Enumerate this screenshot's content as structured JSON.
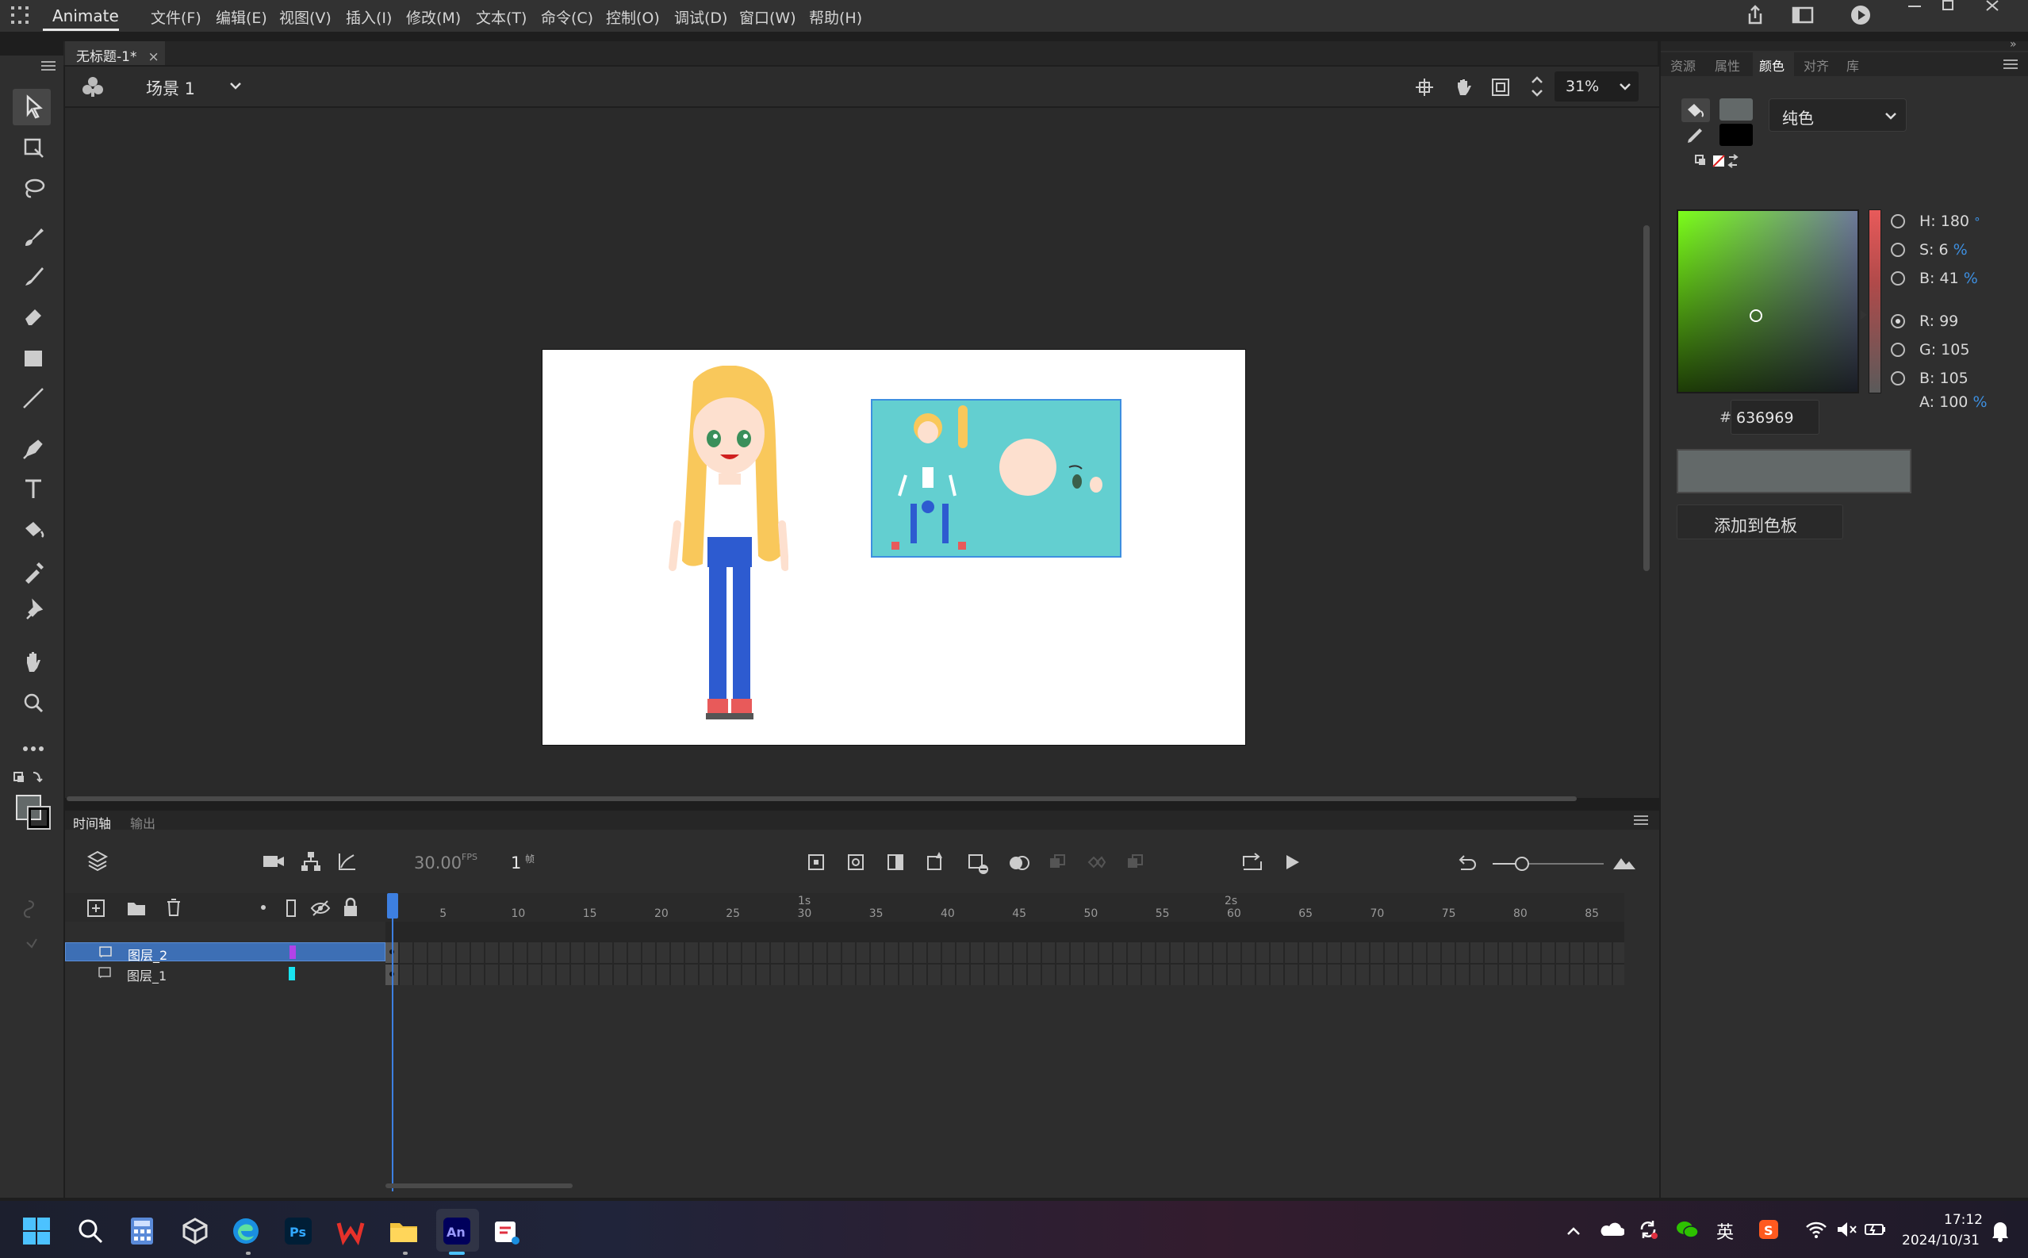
{
  "menubar": {
    "app_name": "Animate",
    "menus": [
      "文件(F)",
      "编辑(E)",
      "视图(V)",
      "插入(I)",
      "修改(M)",
      "文本(T)",
      "命令(C)",
      "控制(O)",
      "调试(D)",
      "窗口(W)",
      "帮助(H)"
    ]
  },
  "document": {
    "tab_title": "无标题-1*",
    "close": "×"
  },
  "scenebar": {
    "scene_name": "场景 1",
    "zoom": "31%"
  },
  "timeline": {
    "tabs": [
      "时间轴",
      "输出"
    ],
    "fps": "30.00",
    "fps_unit": "FPS",
    "current_frame": "1",
    "frame_unit": "帧",
    "seconds_marks": [
      "1s",
      "2s"
    ],
    "frame_numbers": [
      "5",
      "10",
      "15",
      "20",
      "25",
      "30",
      "35",
      "40",
      "45",
      "50",
      "55",
      "60",
      "65",
      "70",
      "75",
      "80",
      "85"
    ],
    "layers": [
      {
        "name": "图层_2",
        "color": "#b143e8",
        "selected": true
      },
      {
        "name": "图层_1",
        "color": "#19e3f0",
        "selected": false
      }
    ]
  },
  "right_panel": {
    "tabs": [
      "资源",
      "属性",
      "颜色",
      "对齐",
      "库"
    ],
    "active_tab": "颜色",
    "fill_type": "纯色",
    "hsb": {
      "h_label": "H:",
      "h": "180",
      "h_unit": "°",
      "s_label": "S:",
      "s": "6",
      "s_unit": "%",
      "b_label": "B:",
      "b": "41",
      "b_unit": "%"
    },
    "rgb": {
      "r_label": "R:",
      "r": "99",
      "g_label": "G:",
      "g": "105",
      "b_label": "B:",
      "b": "105"
    },
    "alpha_label": "A:",
    "alpha": "100",
    "alpha_unit": "%",
    "hex_prefix": "#",
    "hex": "636969",
    "add_swatch": "添加到色板",
    "current_color": "#636969"
  },
  "taskbar": {
    "time": "17:12",
    "date": "2024/10/31",
    "ime": "英"
  },
  "colors": {
    "accent": "#3d6fb5",
    "stage_symbol_bg": "#63cfd0"
  }
}
